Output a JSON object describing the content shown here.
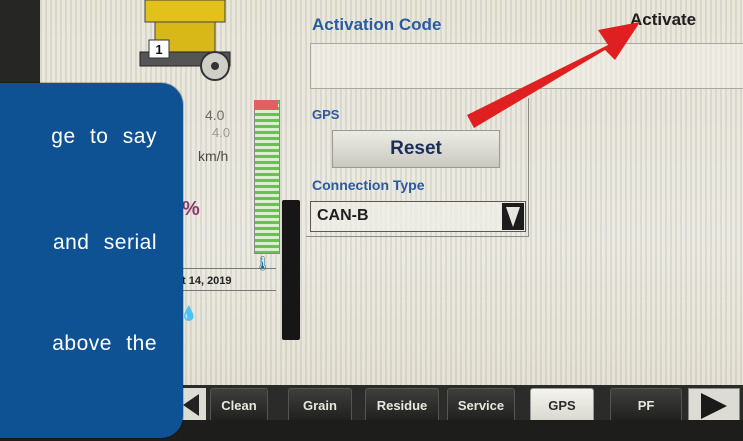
{
  "settings": {
    "activation_label": "Activation Code",
    "activate_label": "Activate",
    "activation_code_value": "",
    "gps_label": "GPS",
    "reset_label": "Reset",
    "connection_type_label": "Connection Type",
    "connection_type_value": "CAN-B"
  },
  "machine_panel": {
    "speed": "4.0",
    "speed_secondary": "4.0",
    "speed_unit": "km/h",
    "percent_fragment": "%",
    "date_fragment": "t 14, 2019",
    "combine_badge": "1"
  },
  "tabs": [
    {
      "label": "Clean"
    },
    {
      "label": "Grain"
    },
    {
      "label": "Residue"
    },
    {
      "label": "Service"
    },
    {
      "label": "GPS"
    },
    {
      "label": "PF"
    }
  ],
  "active_tab": "GPS",
  "callout": {
    "lines": [
      "ge to say",
      "and serial",
      "above the"
    ]
  },
  "colors": {
    "callout_bg": "#0f5294",
    "label_blue": "#2a5aa0",
    "arrow_red": "#e02020"
  }
}
